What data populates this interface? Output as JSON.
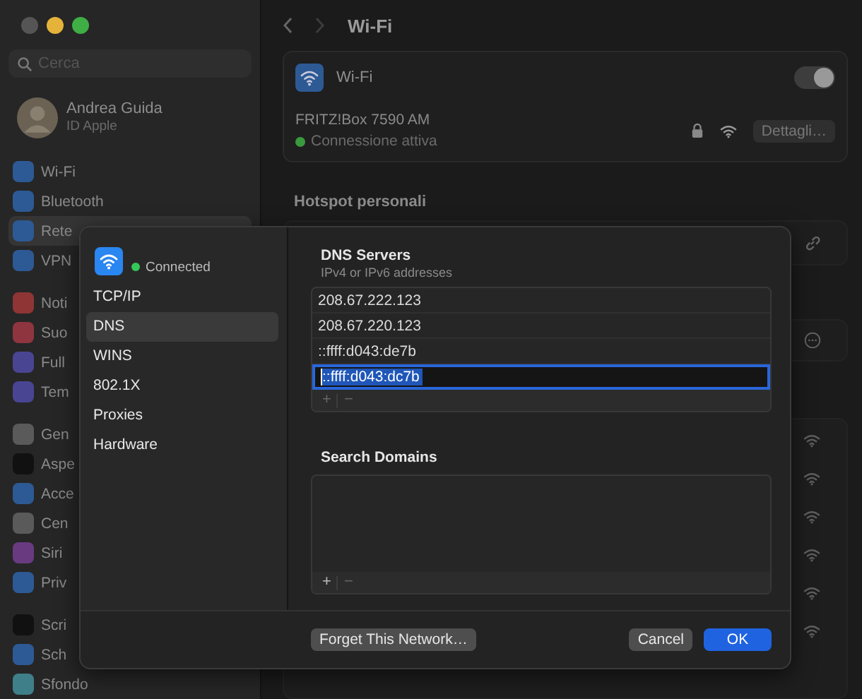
{
  "sidebar": {
    "search": {
      "placeholder": "Cerca"
    },
    "account": {
      "name": "Andrea Guida",
      "subtitle": "ID Apple"
    },
    "groups": [
      [
        {
          "label": "Wi-Fi",
          "color": "#2d5a94",
          "selected": false
        },
        {
          "label": "Bluetooth",
          "color": "#2d5a94",
          "selected": false
        },
        {
          "label": "Rete",
          "color": "#2d5a94",
          "selected": true
        },
        {
          "label": "VPN",
          "color": "#2d5a94",
          "selected": false
        }
      ],
      [
        {
          "label": "Noti",
          "color": "#8f3535",
          "selected": false
        },
        {
          "label": "Suo",
          "color": "#8f3540",
          "selected": false
        },
        {
          "label": "Full",
          "color": "#4a4592",
          "selected": false
        },
        {
          "label": "Tem",
          "color": "#4a4592",
          "selected": false
        }
      ],
      [
        {
          "label": "Gen",
          "color": "#5a5a5a",
          "selected": false
        },
        {
          "label": "Aspe",
          "color": "#111111",
          "selected": false
        },
        {
          "label": "Acce",
          "color": "#2d5a94",
          "selected": false
        },
        {
          "label": "Cen",
          "color": "#5a5a5a",
          "selected": false
        },
        {
          "label": "Siri",
          "color": "#6a3a80",
          "selected": false
        },
        {
          "label": "Priv",
          "color": "#2d5a94",
          "selected": false
        }
      ],
      [
        {
          "label": "Scri",
          "color": "#111111",
          "selected": false
        },
        {
          "label": "Sch",
          "color": "#2d5a94",
          "selected": false
        },
        {
          "label": "Sfondo",
          "color": "#3f7f8a",
          "selected": false
        }
      ]
    ]
  },
  "header": {
    "title": "Wi-Fi"
  },
  "wifi_card": {
    "label": "Wi-Fi",
    "on": true,
    "network": "FRITZ!Box 7590 AM",
    "status": "Connessione attiva",
    "details_button": "Dettagli…"
  },
  "hotspot": {
    "title": "Hotspot personali"
  },
  "dialog": {
    "network": {
      "status": "Connected",
      "connected": true
    },
    "tabs": [
      {
        "label": "TCP/IP",
        "selected": false
      },
      {
        "label": "DNS",
        "selected": true
      },
      {
        "label": "WINS",
        "selected": false
      },
      {
        "label": "802.1X",
        "selected": false
      },
      {
        "label": "Proxies",
        "selected": false
      },
      {
        "label": "Hardware",
        "selected": false
      }
    ],
    "dns": {
      "title": "DNS Servers",
      "subtitle": "IPv4 or IPv6 addresses",
      "servers": [
        {
          "address": "208.67.222.123",
          "selected": false
        },
        {
          "address": "208.67.220.123",
          "selected": false
        },
        {
          "address": "::ffff:d043:de7b",
          "selected": false
        },
        {
          "address": "::ffff:d043:dc7b",
          "selected": true
        }
      ],
      "add": "+",
      "remove": "−"
    },
    "search_domains": {
      "title": "Search Domains",
      "add": "+",
      "remove": "−"
    },
    "buttons": {
      "forget": "Forget This Network…",
      "cancel": "Cancel",
      "ok": "OK"
    }
  }
}
